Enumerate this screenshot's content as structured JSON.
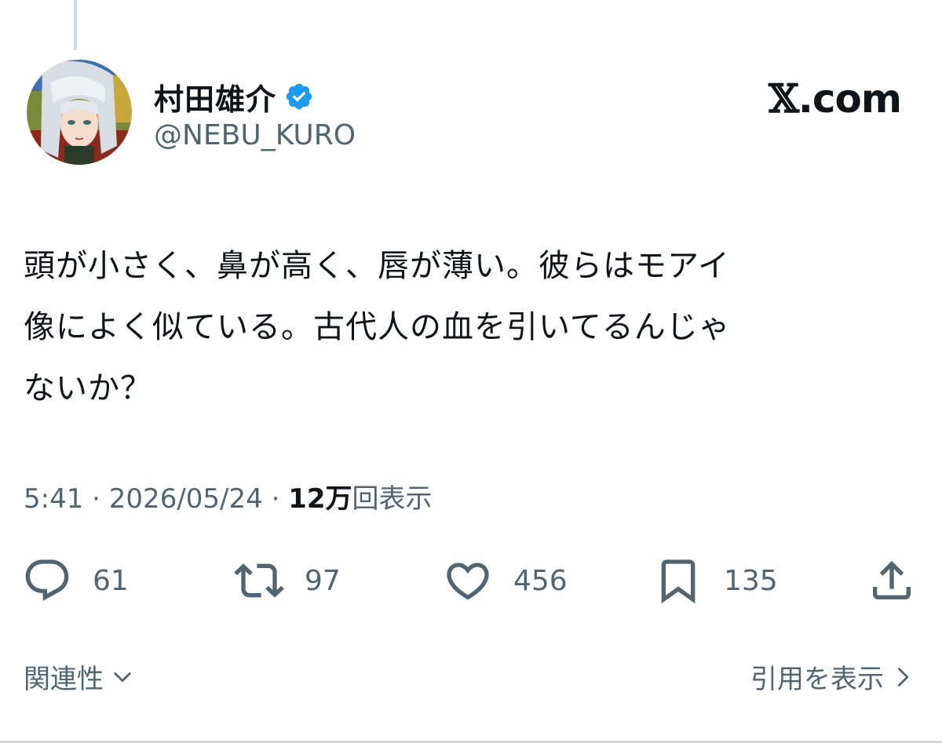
{
  "tweet": {
    "author": {
      "display_name": "村田雄介",
      "handle": "@NEBU_KURO",
      "verified": true,
      "verified_icon": "verified-badge-icon",
      "verified_color": "#1d9bf0"
    },
    "brand": {
      "x_glyph": "𝕏",
      "suffix": ".com"
    },
    "text_lines": [
      "頭が小さく、鼻が高く、唇が薄い。彼らはモアイ",
      "像によく似ている。古代人の血を引いてるんじゃ",
      "ないか？"
    ],
    "meta": {
      "time": "5:41",
      "sep1": " · ",
      "date": "2026/05/24",
      "sep2": " · ",
      "views_count": "12万",
      "views_label": "回表示"
    },
    "actions": {
      "reply": {
        "icon": "reply-icon",
        "count": "61"
      },
      "retweet": {
        "icon": "retweet-icon",
        "count": "97"
      },
      "like": {
        "icon": "heart-icon",
        "count": "456"
      },
      "bookmark": {
        "icon": "bookmark-icon",
        "count": "135"
      },
      "share": {
        "icon": "share-icon"
      }
    },
    "footer": {
      "relevance_label": "関連性",
      "quotes_label": "引用を表示"
    }
  },
  "colors": {
    "text_primary": "#0f1419",
    "text_secondary": "#536471",
    "accent": "#1d9bf0",
    "divider": "#cfd9de"
  }
}
